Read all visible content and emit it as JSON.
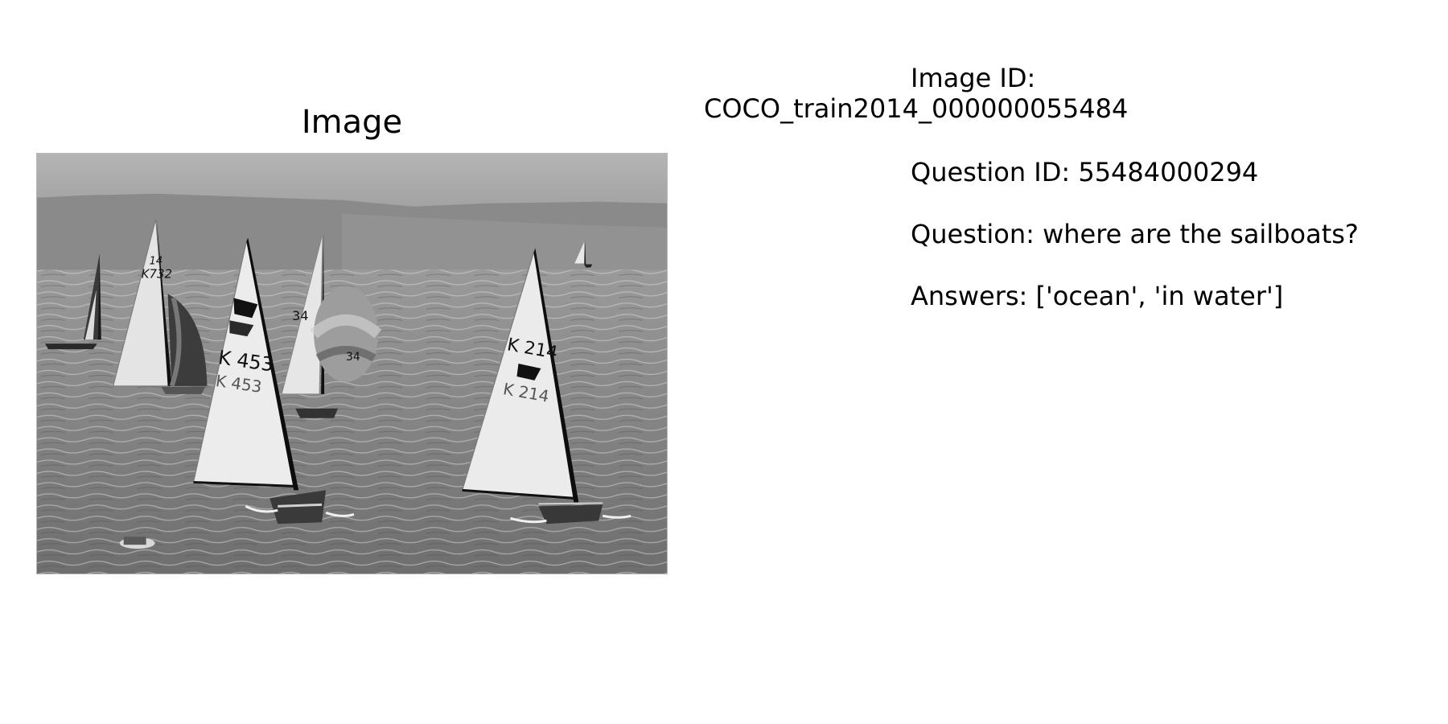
{
  "image_panel": {
    "title": "Image"
  },
  "photo": {
    "sail_numbers": [
      "K 453",
      "K 214",
      "K732",
      "34",
      "14"
    ]
  },
  "info": {
    "image_id_label": "Image ID:",
    "image_id_value": "COCO_train2014_000000055484",
    "question_id": "Question ID: 55484000294",
    "question": "Question: where are the sailboats?",
    "answers": "Answers: ['ocean', 'in water']"
  }
}
